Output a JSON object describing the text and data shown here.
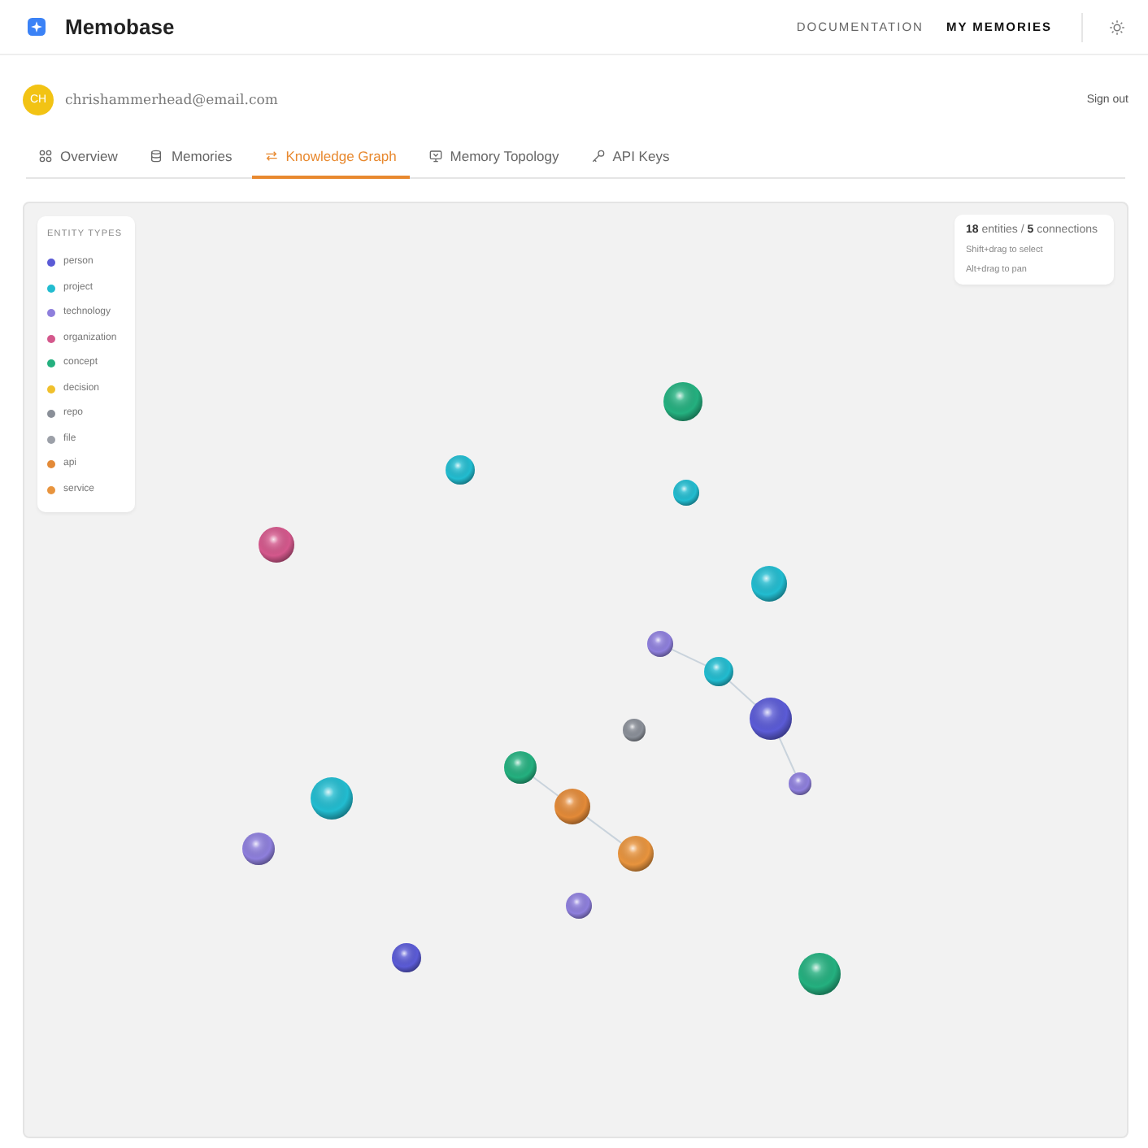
{
  "app": {
    "name": "Memobase"
  },
  "nav": [
    {
      "label": "DOCUMENTATION",
      "selected": false
    },
    {
      "label": "MY MEMORIES",
      "selected": true
    }
  ],
  "user": {
    "initials": "CH",
    "email": "chrishammerhead@email.com",
    "sign_out": "Sign out"
  },
  "tabs": [
    {
      "label": "Overview",
      "selected": false
    },
    {
      "label": "Memories",
      "selected": false
    },
    {
      "label": "Knowledge Graph",
      "selected": true
    },
    {
      "label": "Memory Topology",
      "selected": false
    },
    {
      "label": "API Keys",
      "selected": false
    }
  ],
  "legend": {
    "title": "ENTITY TYPES",
    "items": [
      {
        "label": "person",
        "color": "#5b5bd6"
      },
      {
        "label": "project",
        "color": "#22bcd0"
      },
      {
        "label": "technology",
        "color": "#8e7fdc"
      },
      {
        "label": "organization",
        "color": "#d4588c"
      },
      {
        "label": "concept",
        "color": "#24b07f"
      },
      {
        "label": "decision",
        "color": "#f0c02c"
      },
      {
        "label": "repo",
        "color": "#8a8f98"
      },
      {
        "label": "file",
        "color": "#9ca0a8"
      },
      {
        "label": "api",
        "color": "#e38a38"
      },
      {
        "label": "service",
        "color": "#e8943e"
      }
    ]
  },
  "stats": {
    "summary": "**18** entities / **5** connections",
    "hints": [
      "Shift+drag to select",
      "Alt+drag to pan"
    ]
  }
}
